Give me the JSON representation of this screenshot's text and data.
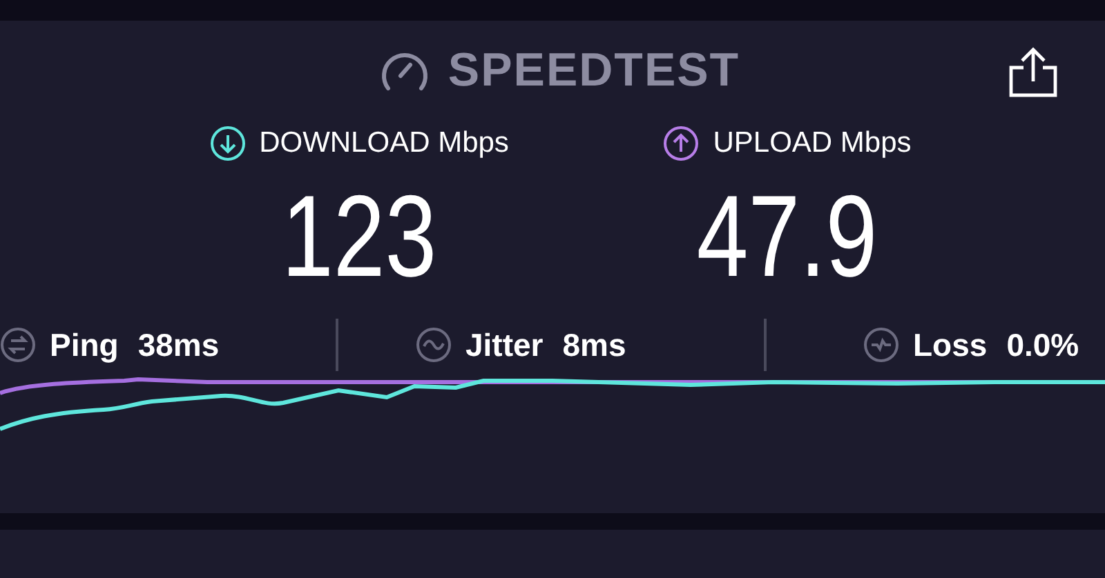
{
  "header": {
    "title": "SPEEDTEST"
  },
  "results": [
    {
      "kind": "download",
      "label": "DOWNLOAD Mbps",
      "value": "123",
      "color": "#5ee6dc"
    },
    {
      "kind": "upload",
      "label": "UPLOAD Mbps",
      "value": "47.9",
      "color": "#b77ee8"
    }
  ],
  "stats": [
    {
      "kind": "ping",
      "label": "Ping",
      "value": "38ms"
    },
    {
      "kind": "jitter",
      "label": "Jitter",
      "value": "8ms"
    },
    {
      "kind": "loss",
      "label": "Loss",
      "value": "0.0%"
    }
  ]
}
